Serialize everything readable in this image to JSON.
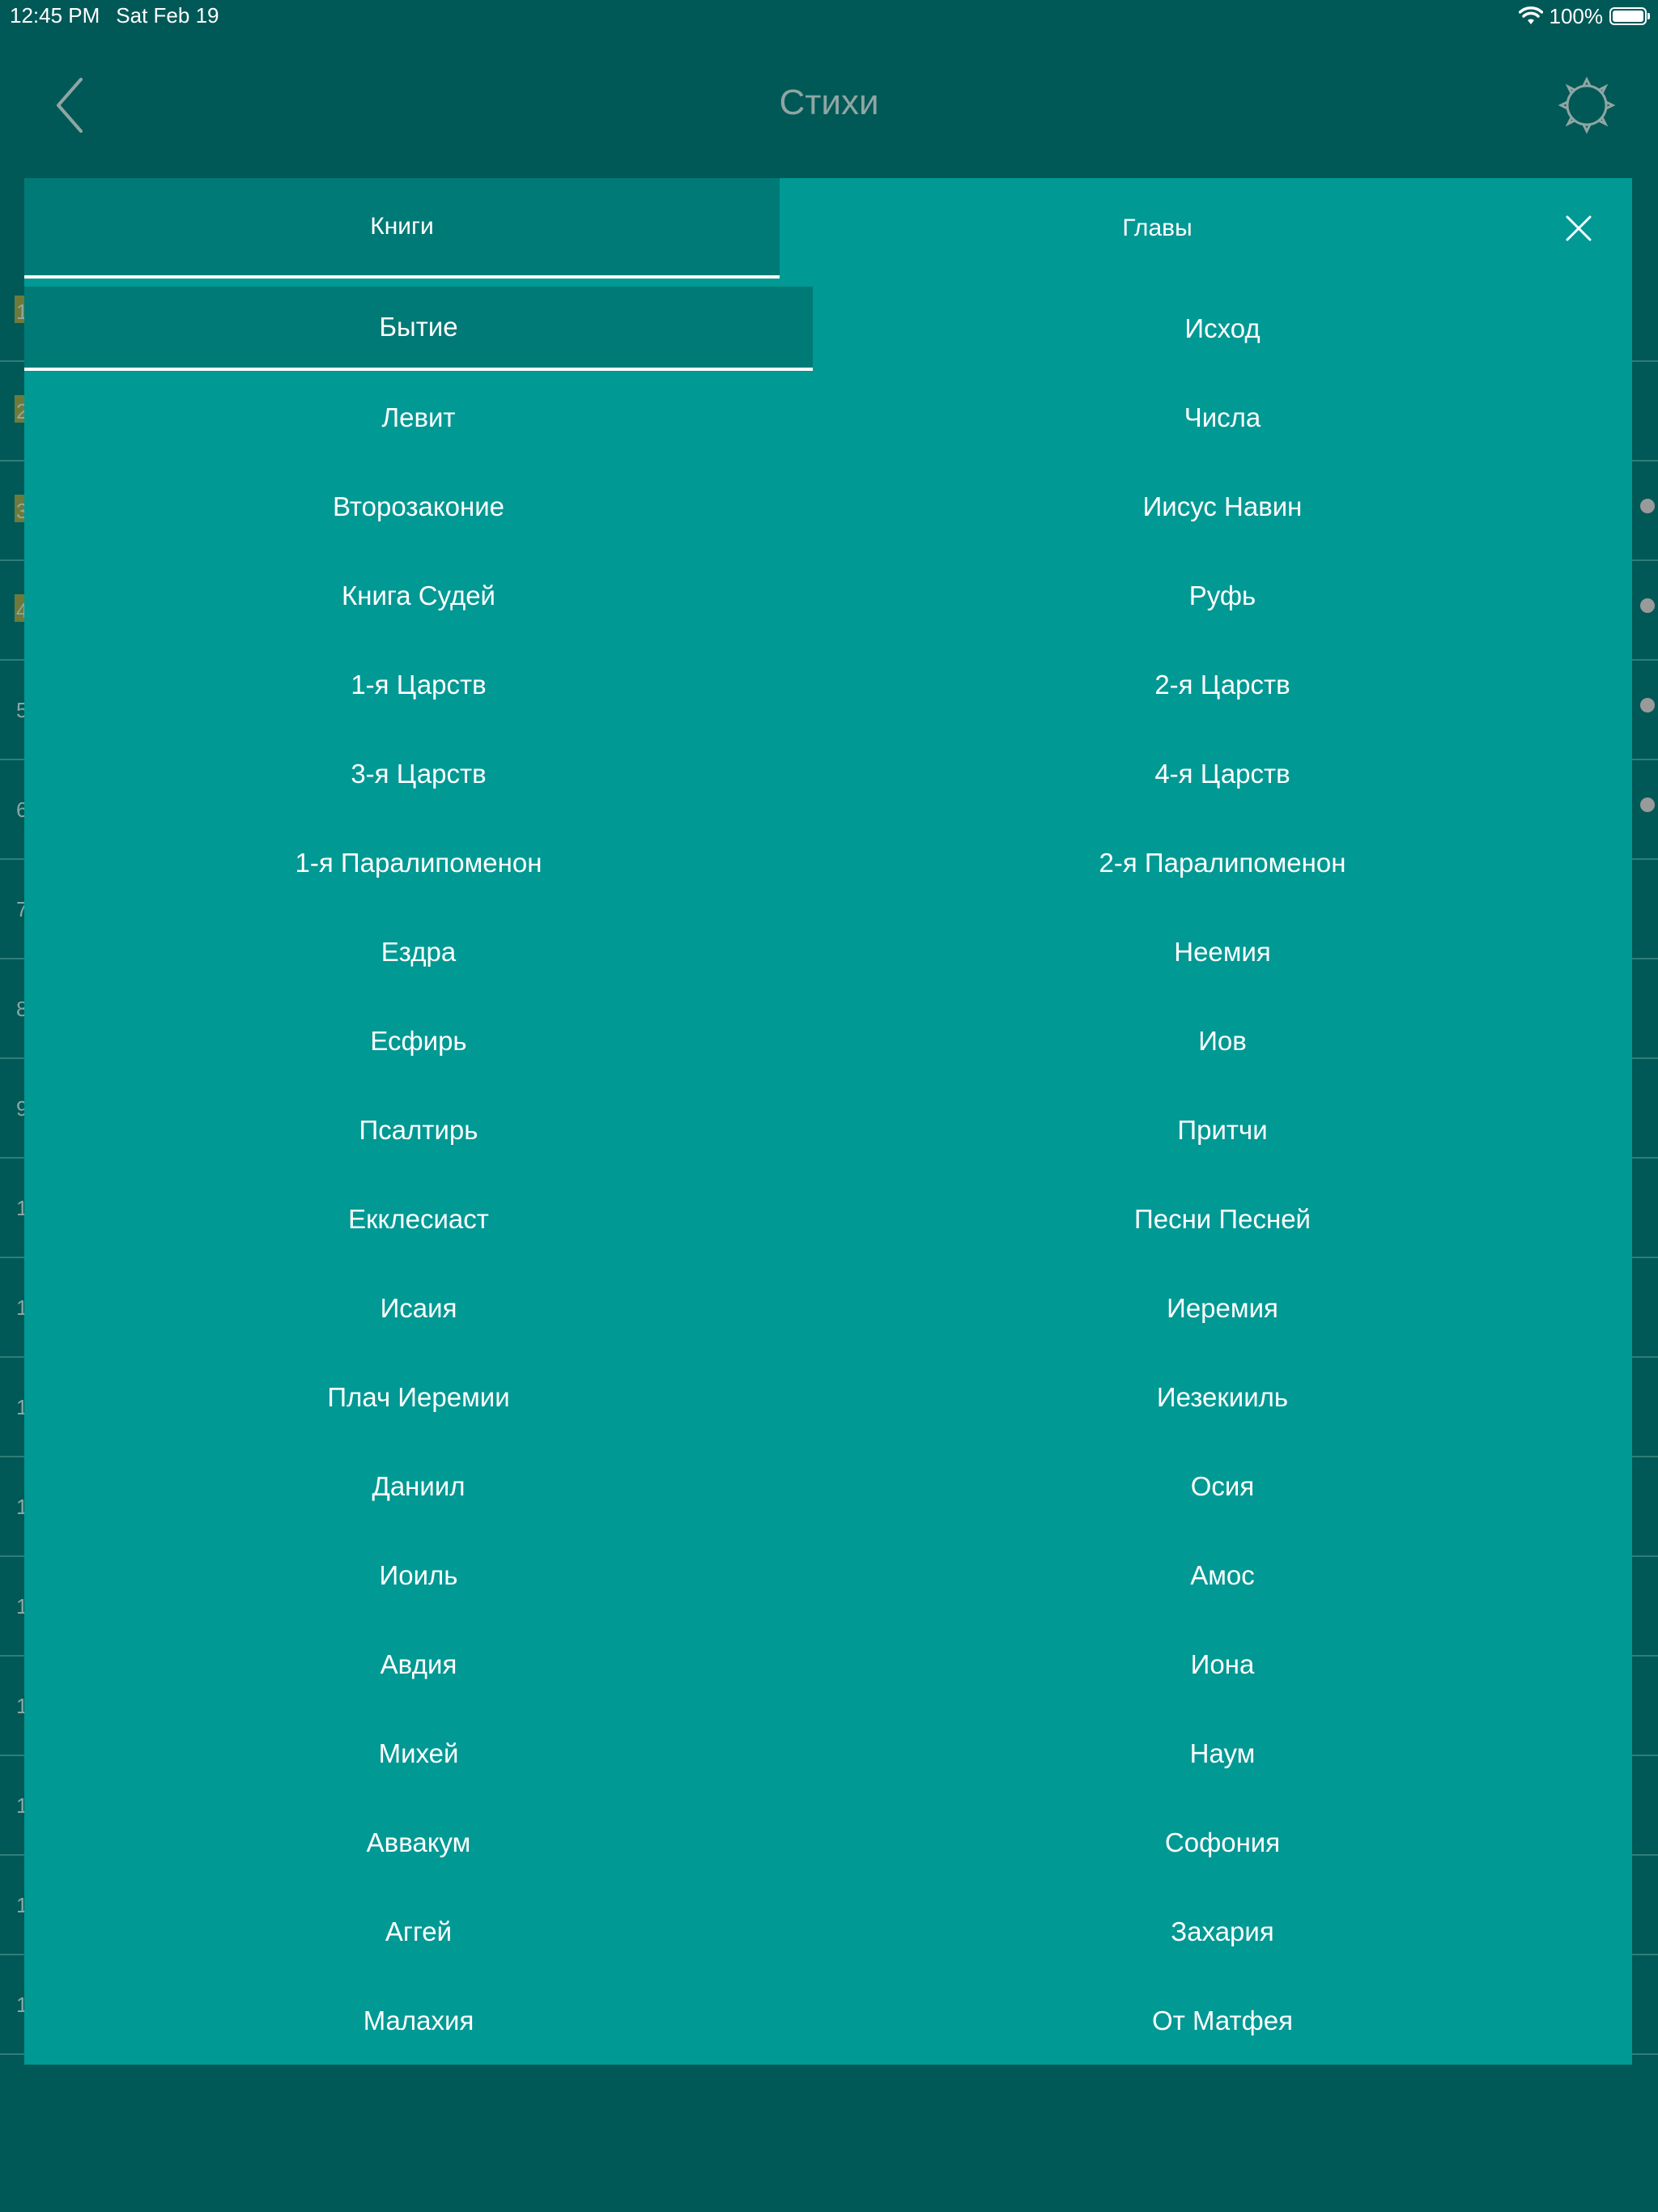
{
  "status": {
    "time": "12:45 PM",
    "date": "Sat Feb 19",
    "battery": "100%",
    "battery_level": 1.0,
    "wifi_icon": "wifi-icon"
  },
  "nav": {
    "title": "Стихи",
    "back_icon": "chevron-left-icon",
    "settings_icon": "gear-icon"
  },
  "modal": {
    "tabs": [
      {
        "label": "Книги",
        "selected": true
      },
      {
        "label": "Главы",
        "selected": false
      }
    ],
    "close_icon": "close-icon",
    "books": [
      "Бытие",
      "Исход",
      "Левит",
      "Числа",
      "Второзаконие",
      "Иисус Навин",
      "Книга Судей",
      "Руфь",
      "1-я Царств",
      "2-я Царств",
      "3-я Царств",
      "4-я Царств",
      "1-я Паралипоменон",
      "2-я Паралипоменон",
      "Ездра",
      "Неемия",
      "Есфирь",
      "Иов",
      "Псалтирь",
      "Притчи",
      "Екклесиаст",
      "Песни Песней",
      "Исаия",
      "Иеремия",
      "Плач Иеремии",
      "Иезекииль",
      "Даниил",
      "Осия",
      "Иоиль",
      "Амос",
      "Авдия",
      "Иона",
      "Михей",
      "Наум",
      "Аввакум",
      "Софония",
      "Аггей",
      "Захария",
      "Малахия",
      "От Матфея"
    ],
    "selected_book": "Бытие"
  },
  "background": {
    "verse_numbers": [
      "1",
      "2",
      "3",
      "4",
      "5",
      "6",
      "7",
      "8",
      "9",
      "1",
      "1",
      "1",
      "1",
      "1",
      "1",
      "1",
      "1",
      "1"
    ]
  }
}
